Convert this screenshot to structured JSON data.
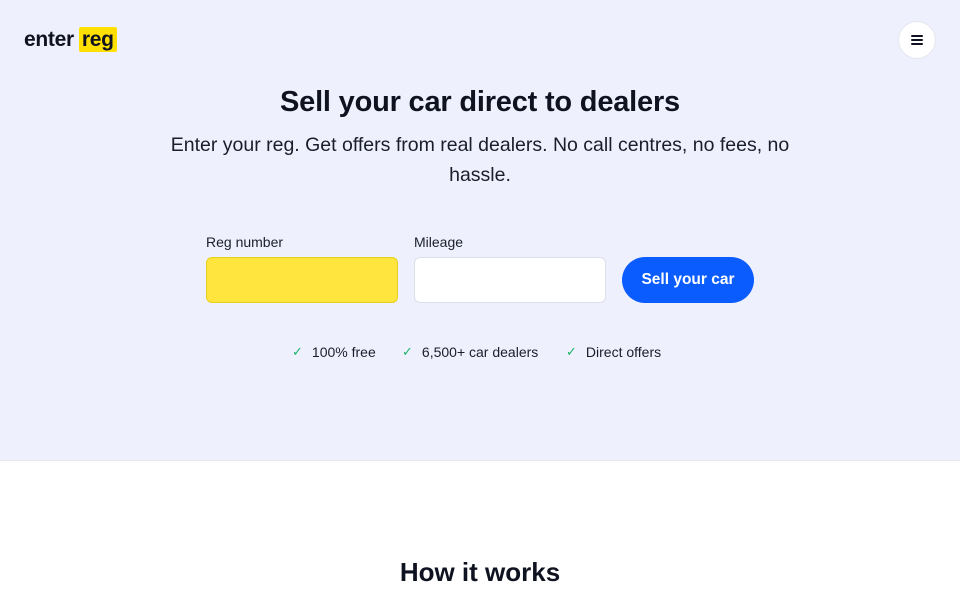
{
  "header": {
    "logo_text_plain": "enter",
    "logo_text_highlight": "reg",
    "menu_icon": "hamburger-menu-icon"
  },
  "hero": {
    "title": "Sell your car direct to dealers",
    "subtitle": "Enter your reg. Get offers from real dealers. No call centres, no fees, no hassle.",
    "form": {
      "reg_label": "Reg number",
      "reg_value": "",
      "mileage_label": "Mileage",
      "mileage_value": "",
      "submit_label": "Sell your car"
    },
    "features": [
      {
        "icon": "check-icon",
        "label": "100% free"
      },
      {
        "icon": "check-icon",
        "label": "6,500+ car dealers"
      },
      {
        "icon": "check-icon",
        "label": "Direct offers"
      }
    ]
  },
  "how_it_works": {
    "title": "How it works"
  },
  "colors": {
    "hero_background": "#eef1fd",
    "brand_yellow": "#ffe000",
    "reg_input_yellow": "#ffe53d",
    "primary_blue": "#0a5cff",
    "check_green": "#1db36b",
    "text_dark": "#0f1220"
  }
}
